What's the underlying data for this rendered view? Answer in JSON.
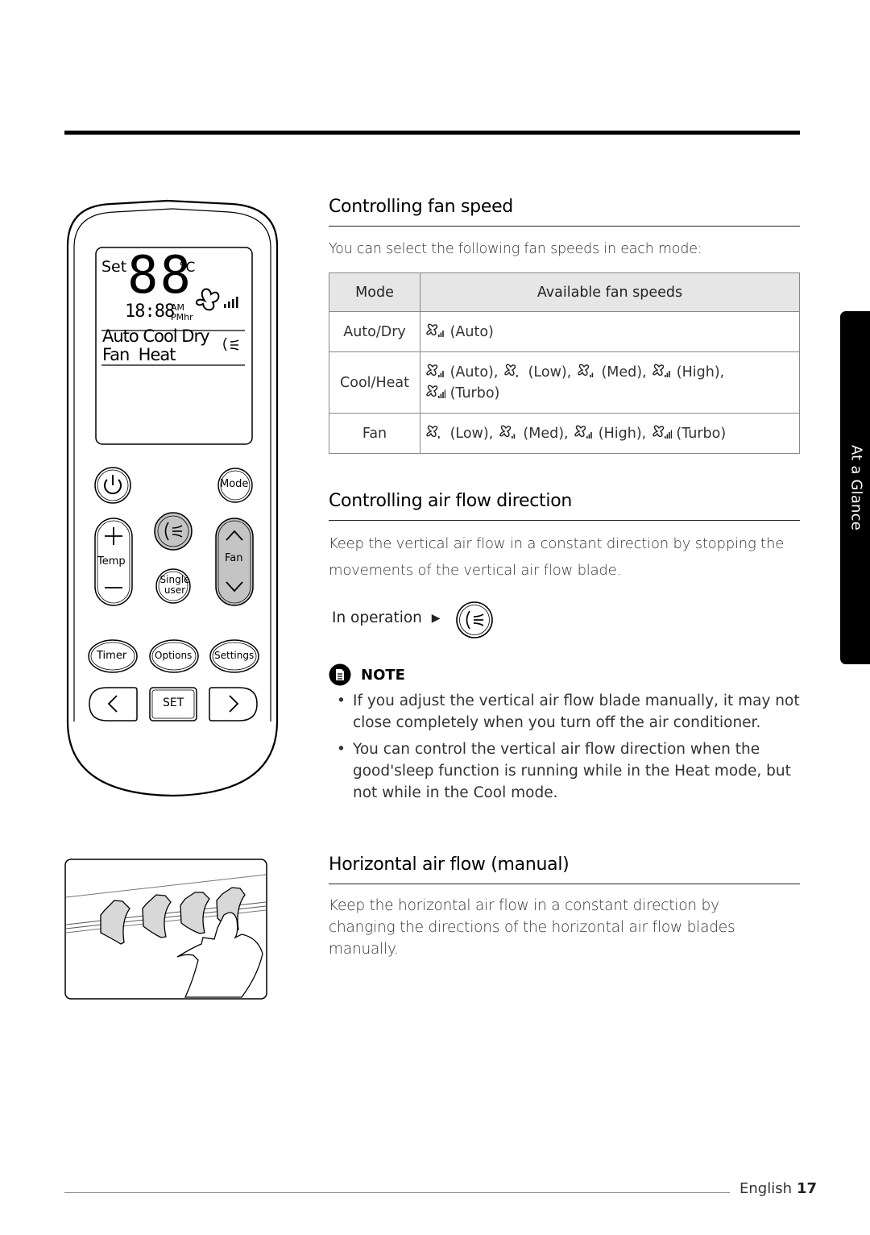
{
  "side_tab": {
    "label": "At a Glance"
  },
  "remote": {
    "display": {
      "set": "Set",
      "temp_digits": "88",
      "temp_unit": "°C",
      "time_digits": "18:88",
      "am": "AM",
      "pm_hr": "PMhr",
      "modes_line1": "Auto Cool Dry",
      "modes_line2": "Fan  Heat"
    },
    "buttons": {
      "mode": "Mode",
      "temp": "Temp",
      "fan": "Fan",
      "single_user_line1": "Single",
      "single_user_line2": "user",
      "timer": "Timer",
      "options": "Options",
      "settings": "Settings",
      "set": "SET"
    },
    "highlight_color": "#c4c4c4"
  },
  "section_fan_speed": {
    "title": "Controlling fan speed",
    "intro": "You can select the following fan speeds in each mode:",
    "table": {
      "headers": [
        "Mode",
        "Available fan speeds"
      ],
      "rows": [
        {
          "mode": "Auto/Dry",
          "speeds": [
            {
              "icon": "fan-auto-icon",
              "label": "(Auto)"
            }
          ]
        },
        {
          "mode": "Cool/Heat",
          "speeds": [
            {
              "icon": "fan-auto-icon",
              "label": "(Auto),"
            },
            {
              "icon": "fan-low-icon",
              "label": "(Low),"
            },
            {
              "icon": "fan-med-icon",
              "label": "(Med),"
            },
            {
              "icon": "fan-high-icon",
              "label": "(High),"
            },
            {
              "icon": "fan-turbo-icon",
              "label": "(Turbo)"
            }
          ]
        },
        {
          "mode": "Fan",
          "speeds": [
            {
              "icon": "fan-low-icon",
              "label": "(Low),"
            },
            {
              "icon": "fan-med-icon",
              "label": "(Med),"
            },
            {
              "icon": "fan-high-icon",
              "label": "(High),"
            },
            {
              "icon": "fan-turbo-icon",
              "label": "(Turbo)"
            }
          ]
        }
      ]
    }
  },
  "section_air_flow": {
    "title": "Controlling air flow direction",
    "text": "Keep the vertical air flow in a constant direction by stopping the movements of the vertical air flow blade.",
    "in_operation": "In operation",
    "note_label": "NOTE",
    "notes": [
      "If you adjust the vertical air flow blade manually, it may not close completely when you turn off the air conditioner.",
      "You can control the vertical air flow direction when the good'sleep function is running while in the Heat mode, but not while in the Cool mode."
    ]
  },
  "section_horizontal": {
    "title": "Horizontal air flow (manual)",
    "text": "Keep the horizontal air flow in a constant direction by changing the directions of the horizontal air flow blades manually."
  },
  "footer": {
    "language": "English",
    "page": "17"
  }
}
